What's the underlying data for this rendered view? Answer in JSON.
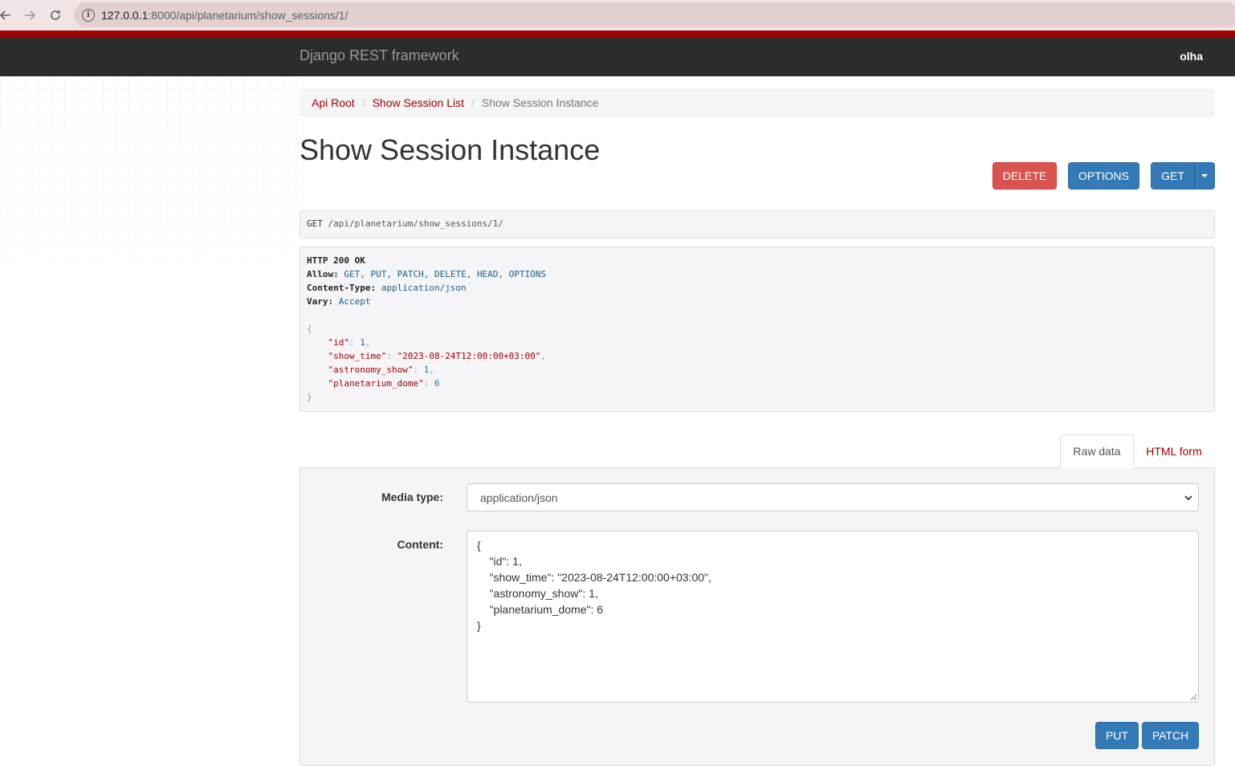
{
  "browser": {
    "url_host": "127.0.0.1",
    "url_rest": ":8000/api/planetarium/show_sessions/1/"
  },
  "navbar": {
    "brand": "Django REST framework",
    "user": "olha"
  },
  "breadcrumb": [
    {
      "label": "Api Root"
    },
    {
      "label": "Show Session List"
    },
    {
      "label": "Show Session Instance"
    }
  ],
  "page": {
    "title": "Show Session Instance"
  },
  "buttons": {
    "delete": "DELETE",
    "options": "OPTIONS",
    "get": "GET",
    "put": "PUT",
    "patch": "PATCH"
  },
  "request": {
    "method": "GET",
    "path": "/api/planetarium/show_sessions/1/"
  },
  "response": {
    "status": "HTTP 200 OK",
    "headers": [
      {
        "key": "Allow:",
        "value": "GET, PUT, PATCH, DELETE, HEAD, OPTIONS"
      },
      {
        "key": "Content-Type:",
        "value": "application/json"
      },
      {
        "key": "Vary:",
        "value": "Accept"
      }
    ],
    "body": [
      {
        "key": "\"id\"",
        "value": "1",
        "kind": "num"
      },
      {
        "key": "\"show_time\"",
        "value": "\"2023-08-24T12:00:00+03:00\"",
        "kind": "str"
      },
      {
        "key": "\"astronomy_show\"",
        "value": "1",
        "kind": "num"
      },
      {
        "key": "\"planetarium_dome\"",
        "value": "6",
        "kind": "num"
      }
    ]
  },
  "tabs": {
    "raw": "Raw data",
    "html": "HTML form"
  },
  "form": {
    "media_label": "Media type:",
    "media_value": "application/json",
    "content_label": "Content:",
    "content_value": "{\n    \"id\": 1,\n    \"show_time\": \"2023-08-24T12:00:00+03:00\",\n    \"astronomy_show\": 1,\n    \"planetarium_dome\": 6\n}"
  },
  "colors": {
    "brand_red": "#a30000",
    "primary": "#337ab7",
    "danger": "#d9534f",
    "navbar": "#2c2c2c"
  }
}
